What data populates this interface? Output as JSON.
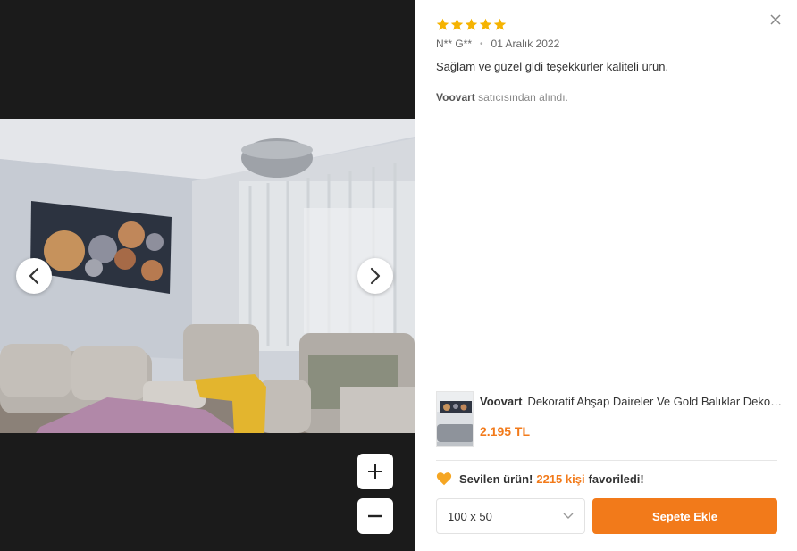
{
  "review": {
    "rating": 5,
    "author": "N** G**",
    "date": "01 Aralık 2022",
    "comment": "Sağlam ve güzel gldi teşekkürler kaliteli ürün.",
    "seller_name": "Voovart",
    "seller_suffix": "satıcısından alındı."
  },
  "product": {
    "brand": "Voovart",
    "title": "Dekoratif Ahşap Daireler Ve Gold Balıklar Dekoratif Tablo",
    "price": "2.195 TL"
  },
  "favorite": {
    "label": "Sevilen ürün!",
    "count": "2215 kişi",
    "tail": "favoriledi!"
  },
  "size_select": {
    "value": "100 x 50"
  },
  "actions": {
    "add_to_cart": "Sepete Ekle"
  },
  "colors": {
    "accent": "#f27a1a",
    "star": "#f5b301",
    "viewer_bg": "#1b1b1b"
  },
  "icons": {
    "close": "close-icon",
    "prev": "chevron-left-icon",
    "next": "chevron-right-icon",
    "zoom_in": "plus-icon",
    "zoom_out": "minus-icon",
    "heart": "heart-icon",
    "dropdown": "chevron-down-icon",
    "star": "star-icon"
  }
}
